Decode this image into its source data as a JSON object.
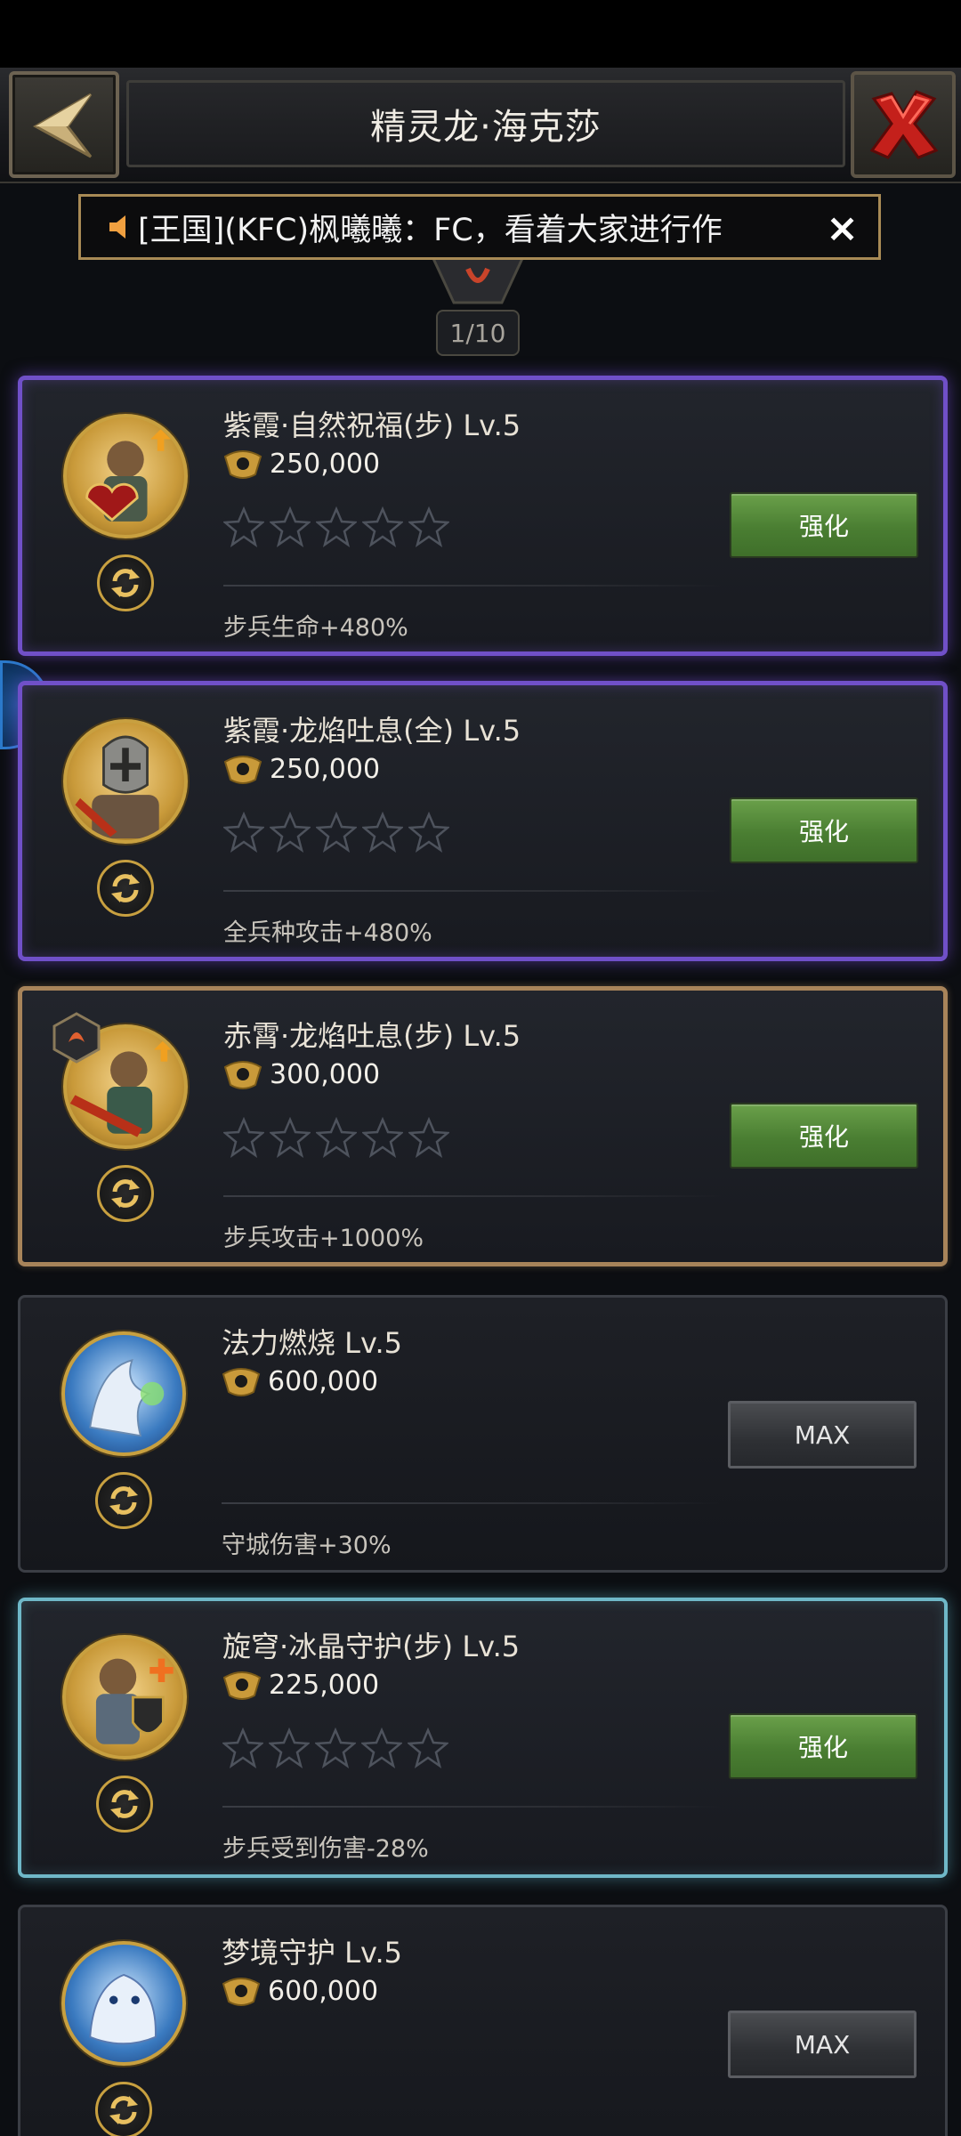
{
  "header": {
    "title": "精灵龙·海克莎"
  },
  "marquee": {
    "text": "[王国](KFC)枫曦曦：FC，看着大家进行作",
    "close": "×"
  },
  "pager": {
    "text": "1/10"
  },
  "cards": [
    {
      "name": "紫霞·自然祝福(步) Lv.5",
      "cost": "250,000",
      "effect": "步兵生命+480%",
      "button": "强化",
      "stars": 0,
      "stars_total": 5
    },
    {
      "name": "紫霞·龙焰吐息(全) Lv.5",
      "cost": "250,000",
      "effect": "全兵种攻击+480%",
      "button": "强化",
      "stars": 0,
      "stars_total": 5
    },
    {
      "name": "赤霄·龙焰吐息(步) Lv.5",
      "cost": "300,000",
      "effect": "步兵攻击+1000%",
      "button": "强化",
      "stars": 0,
      "stars_total": 5
    },
    {
      "name": "法力燃烧 Lv.5",
      "cost": "600,000",
      "effect": "守城伤害+30%",
      "button": "MAX"
    },
    {
      "name": "旋穹·冰晶守护(步) Lv.5",
      "cost": "225,000",
      "effect": "步兵受到伤害-28%",
      "button": "强化",
      "stars": 0,
      "stars_total": 5
    },
    {
      "name": "梦境守护 Lv.5",
      "cost": "600,000",
      "effect": "",
      "button": "MAX"
    }
  ],
  "colors": {
    "upgrade_green": "#4a7e32",
    "purple_frame": "#7050c8",
    "gold_frame": "#a8845a",
    "teal_frame": "#6fb8c8"
  },
  "icons": {
    "back": "back-arrow-icon",
    "close": "close-x-icon",
    "coin": "crest-coin-icon",
    "star": "star-outline-icon",
    "refresh": "refresh-icon",
    "speaker": "speaker-icon"
  }
}
